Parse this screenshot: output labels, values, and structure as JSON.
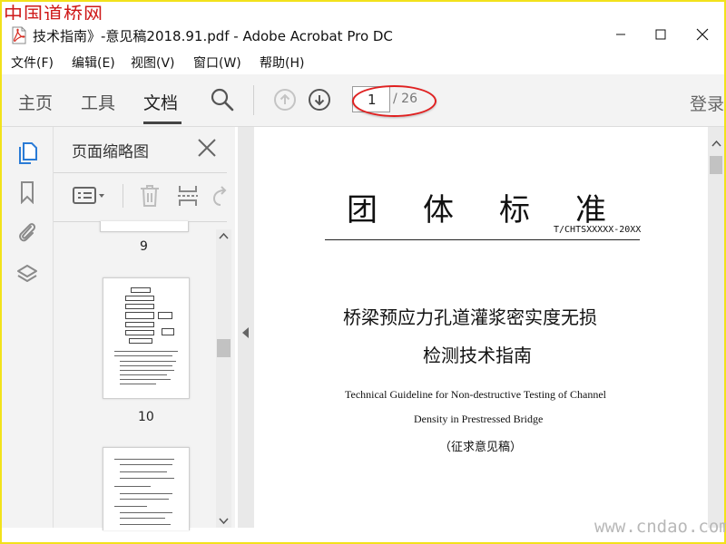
{
  "watermark_top": "中国道桥网",
  "watermark_bottom": "www.cndao.com",
  "window": {
    "title": "技术指南》-意见稿2018.91.pdf - Adobe Acrobat Pro DC",
    "icon": "pdf-file-icon"
  },
  "menu": [
    "文件(F)",
    "编辑(E)",
    "视图(V)",
    "窗口(W)",
    "帮助(H)"
  ],
  "toolbar": {
    "tabs": [
      "主页",
      "工具",
      "文档"
    ],
    "active_tab": "文档",
    "current_page": "1",
    "total_pages": "/ 26",
    "login": "登录"
  },
  "thumbnails_panel": {
    "title": "页面缩略图",
    "pages": [
      "9",
      "10"
    ]
  },
  "document": {
    "heading": "团体标准",
    "code": "T/CHTSXXXXX-20XX",
    "title_cn_line1": "桥梁预应力孔道灌浆密实度无损",
    "title_cn_line2": "检测技术指南",
    "title_en_line1": "Technical Guideline for Non-destructive Testing of Channel",
    "title_en_line2": "Density in Prestressed Bridge",
    "draft_note": "（征求意见稿）"
  },
  "colors": {
    "frame": "#f2e21b",
    "accent_blue": "#2a7bd6",
    "annotation_red": "#e02020",
    "watermark_red": "#cf1a1a"
  }
}
